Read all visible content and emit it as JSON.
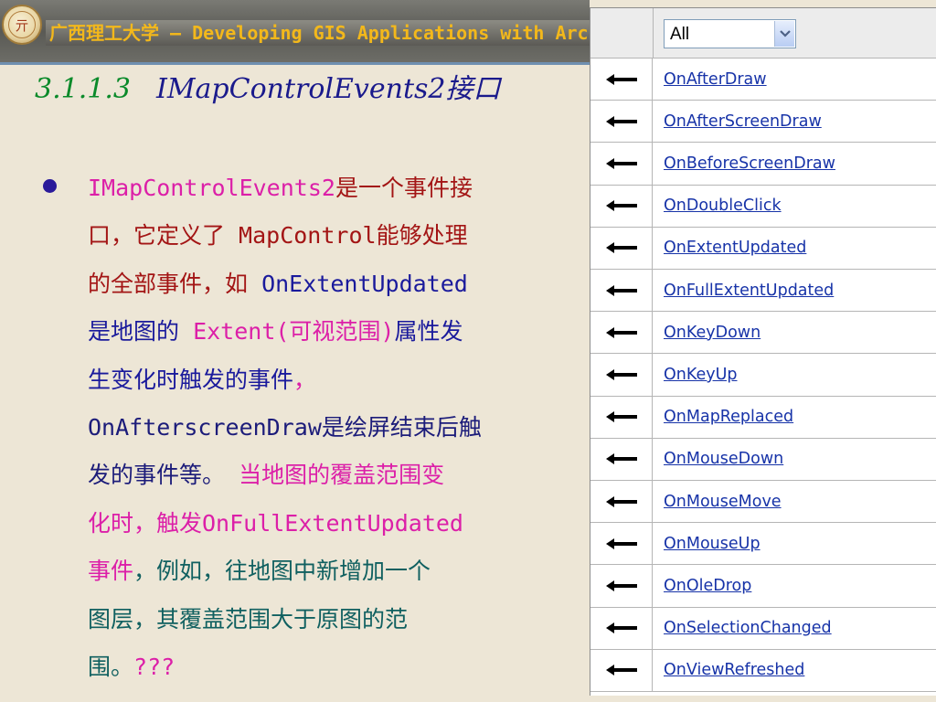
{
  "header": {
    "logo_glyph": "亓",
    "title": "广西理工大学 — Developing GIS Applications with ArcObjects"
  },
  "section": {
    "number": "3.1.1.3",
    "title": "IMapControlEvents2接口"
  },
  "bullet": {
    "lines": [
      [
        {
          "text": "IMapControlEvents2",
          "color": "magenta"
        },
        {
          "text": "是一个事件接",
          "color": "red"
        }
      ],
      [
        {
          "text": "口，它定义了 MapControl能够处理",
          "color": "red"
        }
      ],
      [
        {
          "text": "的全部事件，如 ",
          "color": "red"
        },
        {
          "text": "OnExtentUpdated",
          "color": "blue"
        }
      ],
      [
        {
          "text": "是地图的 ",
          "color": "blue"
        },
        {
          "text": "Extent(可视范围)",
          "color": "magenta"
        },
        {
          "text": "属性发",
          "color": "blue"
        }
      ],
      [
        {
          "text": "生变化时触发的事件",
          "color": "blue"
        },
        {
          "text": "，",
          "color": "magenta"
        }
      ],
      [
        {
          "text": "OnAfterscreenDraw是绘屏结束后触",
          "color": "navy"
        }
      ],
      [
        {
          "text": "发的事件等。 ",
          "color": "navy"
        },
        {
          "text": "当地图的覆盖范围变",
          "color": "magenta"
        }
      ],
      [
        {
          "text": "化时，触发OnFullExtentUpdated",
          "color": "magenta"
        }
      ],
      [
        {
          "text": "事件",
          "color": "magenta"
        },
        {
          "text": "，例如，往地图中新增加一个",
          "color": "green"
        }
      ],
      [
        {
          "text": "图层，其覆盖范围大于原图的范",
          "color": "green"
        }
      ],
      [
        {
          "text": "围。",
          "color": "green"
        },
        {
          "text": "???",
          "color": "magenta"
        }
      ]
    ]
  },
  "events_panel": {
    "filter": {
      "selected": "All"
    },
    "events": [
      "OnAfterDraw",
      "OnAfterScreenDraw",
      "OnBeforeScreenDraw",
      "OnDoubleClick",
      "OnExtentUpdated",
      "OnFullExtentUpdated",
      "OnKeyDown",
      "OnKeyUp",
      "OnMapReplaced",
      "OnMouseDown",
      "OnMouseMove",
      "OnMouseUp",
      "OnOleDrop",
      "OnSelectionChanged",
      "OnViewRefreshed"
    ],
    "row_icon": "left-arrow-icon"
  },
  "colors": {
    "magenta": "#dc1fa8",
    "red": "#a31515",
    "blue": "#1a1a9c",
    "navy": "#1c1c7a",
    "green": "#106060",
    "link": "#1733a8",
    "header_title": "#f3b81b"
  }
}
